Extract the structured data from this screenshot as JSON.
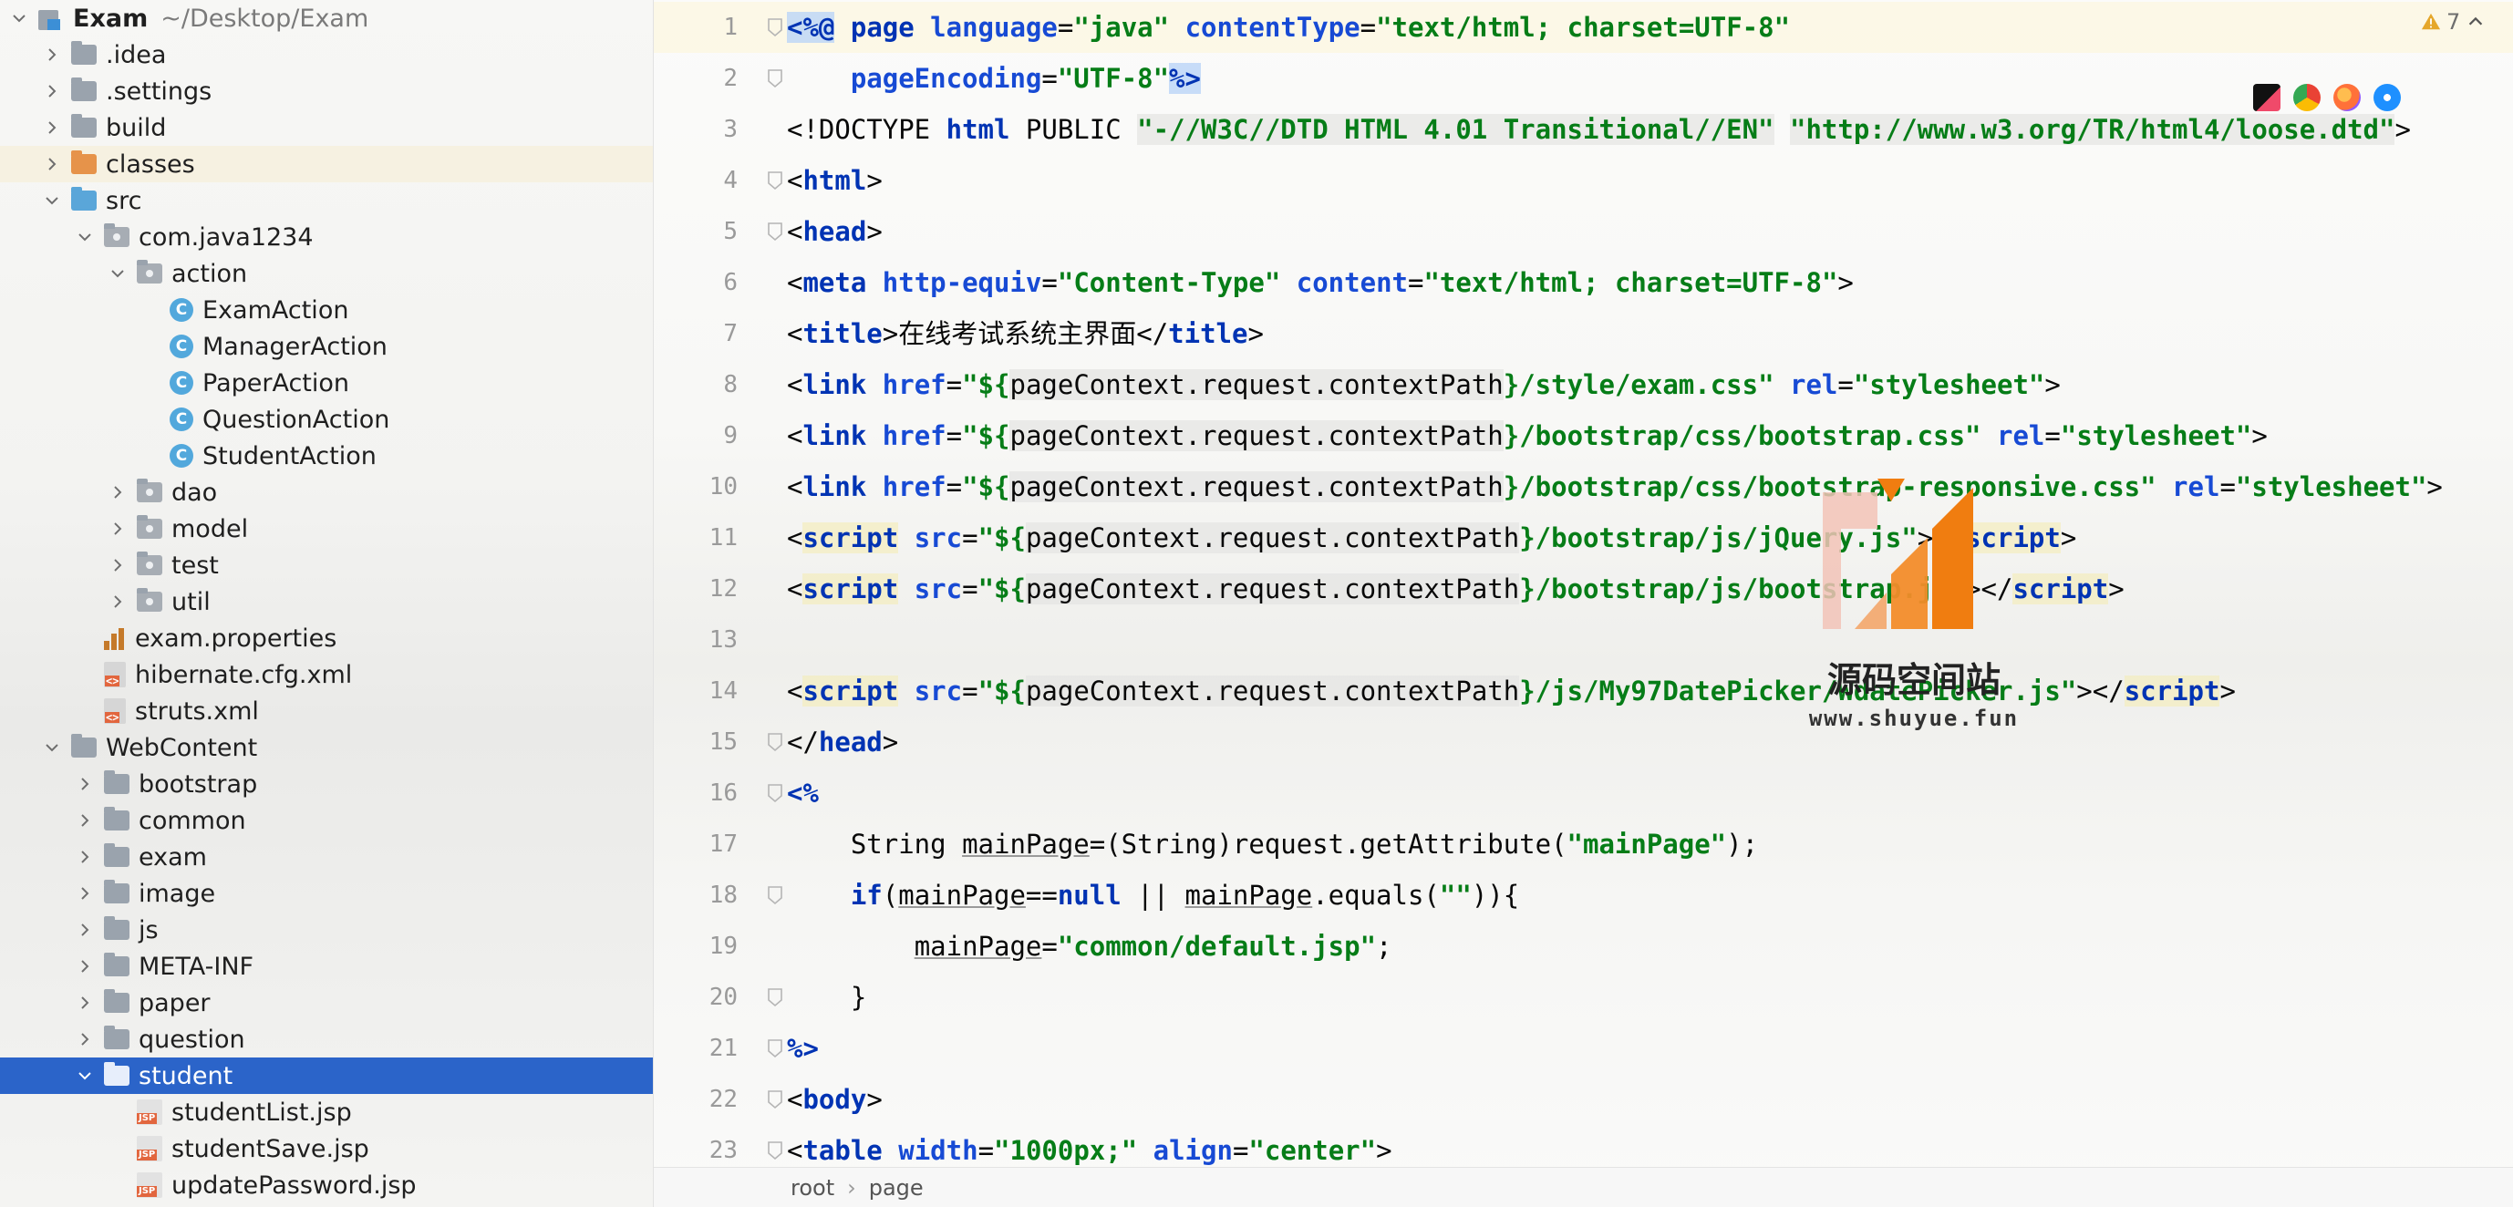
{
  "project": {
    "name": "Exam",
    "path": "~/Desktop/Exam",
    "tree": [
      {
        "label": "Exam",
        "path": "~/Desktop/Exam",
        "depth": 0,
        "type": "project",
        "state": "open"
      },
      {
        "label": ".idea",
        "depth": 1,
        "type": "folder",
        "state": "closed"
      },
      {
        "label": ".settings",
        "depth": 1,
        "type": "folder",
        "state": "closed"
      },
      {
        "label": "build",
        "depth": 1,
        "type": "folder",
        "state": "closed"
      },
      {
        "label": "classes",
        "depth": 1,
        "type": "folder-orange",
        "state": "closed",
        "highlight": true
      },
      {
        "label": "src",
        "depth": 1,
        "type": "folder-blue",
        "state": "open"
      },
      {
        "label": "com.java1234",
        "depth": 2,
        "type": "package",
        "state": "open"
      },
      {
        "label": "action",
        "depth": 3,
        "type": "package",
        "state": "open"
      },
      {
        "label": "ExamAction",
        "depth": 4,
        "type": "class",
        "state": "none"
      },
      {
        "label": "ManagerAction",
        "depth": 4,
        "type": "class",
        "state": "none"
      },
      {
        "label": "PaperAction",
        "depth": 4,
        "type": "class",
        "state": "none"
      },
      {
        "label": "QuestionAction",
        "depth": 4,
        "type": "class",
        "state": "none"
      },
      {
        "label": "StudentAction",
        "depth": 4,
        "type": "class",
        "state": "none"
      },
      {
        "label": "dao",
        "depth": 3,
        "type": "package",
        "state": "closed"
      },
      {
        "label": "model",
        "depth": 3,
        "type": "package",
        "state": "closed"
      },
      {
        "label": "test",
        "depth": 3,
        "type": "package",
        "state": "closed"
      },
      {
        "label": "util",
        "depth": 3,
        "type": "package",
        "state": "closed"
      },
      {
        "label": "exam.properties",
        "depth": 2,
        "type": "properties",
        "state": "none"
      },
      {
        "label": "hibernate.cfg.xml",
        "depth": 2,
        "type": "xml",
        "state": "none"
      },
      {
        "label": "struts.xml",
        "depth": 2,
        "type": "xml",
        "state": "none"
      },
      {
        "label": "WebContent",
        "depth": 1,
        "type": "folder",
        "state": "open"
      },
      {
        "label": "bootstrap",
        "depth": 2,
        "type": "folder",
        "state": "closed"
      },
      {
        "label": "common",
        "depth": 2,
        "type": "folder",
        "state": "closed"
      },
      {
        "label": "exam",
        "depth": 2,
        "type": "folder",
        "state": "closed"
      },
      {
        "label": "image",
        "depth": 2,
        "type": "folder",
        "state": "closed"
      },
      {
        "label": "js",
        "depth": 2,
        "type": "folder",
        "state": "closed"
      },
      {
        "label": "META-INF",
        "depth": 2,
        "type": "folder",
        "state": "closed"
      },
      {
        "label": "paper",
        "depth": 2,
        "type": "folder",
        "state": "closed"
      },
      {
        "label": "question",
        "depth": 2,
        "type": "folder",
        "state": "closed"
      },
      {
        "label": "student",
        "depth": 2,
        "type": "folder",
        "state": "open",
        "selected": true
      },
      {
        "label": "studentList.jsp",
        "depth": 3,
        "type": "jsp",
        "state": "none"
      },
      {
        "label": "studentSave.jsp",
        "depth": 3,
        "type": "jsp",
        "state": "none"
      },
      {
        "label": "updatePassword.jsp",
        "depth": 3,
        "type": "jsp",
        "state": "none"
      }
    ]
  },
  "editor": {
    "warnings_icon": "warning-triangle-icon",
    "warnings_count": "7",
    "browser_icons": [
      "intellij-icon",
      "chrome-icon",
      "firefox-icon",
      "safari-icon"
    ],
    "current_line": 1,
    "lines": [
      {
        "n": "1",
        "fold": true,
        "segs": [
          [
            "hlbg el",
            "<%@"
          ],
          [
            "pl",
            " "
          ],
          [
            "el",
            "page"
          ],
          [
            "pl",
            " "
          ],
          [
            "attr",
            "language"
          ],
          [
            "pl",
            "="
          ],
          [
            "str",
            "\"java\""
          ],
          [
            "pl",
            " "
          ],
          [
            "attr",
            "contentType"
          ],
          [
            "pl",
            "="
          ],
          [
            "str",
            "\"text/html; charset=UTF-8\""
          ]
        ]
      },
      {
        "n": "2",
        "fold": true,
        "segs": [
          [
            "pl",
            "    "
          ],
          [
            "attr",
            "pageEncoding"
          ],
          [
            "pl",
            "="
          ],
          [
            "str",
            "\"UTF-8\""
          ],
          [
            "hlbg el",
            "%>"
          ]
        ]
      },
      {
        "n": "3",
        "fold": false,
        "segs": [
          [
            "pl",
            "<!DOCTYPE "
          ],
          [
            "tag",
            "html"
          ],
          [
            "pl",
            " PUBLIC "
          ],
          [
            "str ebg",
            "\"-//W3C//DTD HTML 4.01 Transitional//EN\""
          ],
          [
            "pl",
            " "
          ],
          [
            "str ebg",
            "\"http://www.w3.org/TR/html4/loose.dtd\""
          ],
          [
            "pl",
            ">"
          ]
        ]
      },
      {
        "n": "4",
        "fold": true,
        "segs": [
          [
            "pl",
            "<"
          ],
          [
            "tag",
            "html"
          ],
          [
            "pl",
            ">"
          ]
        ]
      },
      {
        "n": "5",
        "fold": true,
        "segs": [
          [
            "pl",
            "<"
          ],
          [
            "tag",
            "head"
          ],
          [
            "pl",
            ">"
          ]
        ]
      },
      {
        "n": "6",
        "fold": false,
        "segs": [
          [
            "pl",
            "<"
          ],
          [
            "tag",
            "meta"
          ],
          [
            "pl",
            " "
          ],
          [
            "attr",
            "http-equiv"
          ],
          [
            "pl",
            "="
          ],
          [
            "str",
            "\"Content-Type\""
          ],
          [
            "pl",
            " "
          ],
          [
            "attr",
            "content"
          ],
          [
            "pl",
            "="
          ],
          [
            "str",
            "\"text/html; charset=UTF-8\""
          ],
          [
            "pl",
            ">"
          ]
        ]
      },
      {
        "n": "7",
        "fold": false,
        "segs": [
          [
            "pl",
            "<"
          ],
          [
            "tag",
            "title"
          ],
          [
            "pl",
            ">在线考试系统主界面</"
          ],
          [
            "tag",
            "title"
          ],
          [
            "pl",
            ">"
          ]
        ]
      },
      {
        "n": "8",
        "fold": false,
        "segs": [
          [
            "pl",
            "<"
          ],
          [
            "tag",
            "link"
          ],
          [
            "pl",
            " "
          ],
          [
            "attr",
            "href"
          ],
          [
            "pl",
            "="
          ],
          [
            "str",
            "\"${"
          ],
          [
            "pl ebg",
            "pageContext.request.contextPath"
          ],
          [
            "str",
            "}/style/exam.css\""
          ],
          [
            "pl",
            " "
          ],
          [
            "attr",
            "rel"
          ],
          [
            "pl",
            "="
          ],
          [
            "str",
            "\"stylesheet\""
          ],
          [
            "pl",
            ">"
          ]
        ]
      },
      {
        "n": "9",
        "fold": false,
        "segs": [
          [
            "pl",
            "<"
          ],
          [
            "tag",
            "link"
          ],
          [
            "pl",
            " "
          ],
          [
            "attr",
            "href"
          ],
          [
            "pl",
            "="
          ],
          [
            "str",
            "\"${"
          ],
          [
            "pl ebg",
            "pageContext.request.contextPath"
          ],
          [
            "str",
            "}/bootstrap/css/bootstrap.css\""
          ],
          [
            "pl",
            " "
          ],
          [
            "attr",
            "rel"
          ],
          [
            "pl",
            "="
          ],
          [
            "str",
            "\"stylesheet\""
          ],
          [
            "pl",
            ">"
          ]
        ]
      },
      {
        "n": "10",
        "fold": false,
        "segs": [
          [
            "pl",
            "<"
          ],
          [
            "tag",
            "link"
          ],
          [
            "pl",
            " "
          ],
          [
            "attr",
            "href"
          ],
          [
            "pl",
            "="
          ],
          [
            "str",
            "\"${"
          ],
          [
            "pl ebg",
            "pageContext.request.contextPath"
          ],
          [
            "str",
            "}/bootstrap/css/bootstrap-responsive.css\""
          ],
          [
            "pl",
            " "
          ],
          [
            "attr",
            "rel"
          ],
          [
            "pl",
            "="
          ],
          [
            "str",
            "\"stylesheet\""
          ],
          [
            "pl",
            ">"
          ]
        ]
      },
      {
        "n": "11",
        "fold": false,
        "segs": [
          [
            "pl",
            "<"
          ],
          [
            "tag scrbg",
            "script"
          ],
          [
            "pl",
            " "
          ],
          [
            "attr",
            "src"
          ],
          [
            "pl",
            "="
          ],
          [
            "str",
            "\"${"
          ],
          [
            "pl ebg",
            "pageContext.request.contextPath"
          ],
          [
            "str",
            "}/bootstrap/js/jQuery.js\""
          ],
          [
            "pl",
            "></"
          ],
          [
            "tag scrbg",
            "script"
          ],
          [
            "pl",
            ">"
          ]
        ]
      },
      {
        "n": "12",
        "fold": false,
        "segs": [
          [
            "pl",
            "<"
          ],
          [
            "tag scrbg",
            "script"
          ],
          [
            "pl",
            " "
          ],
          [
            "attr",
            "src"
          ],
          [
            "pl",
            "="
          ],
          [
            "str",
            "\"${"
          ],
          [
            "pl ebg",
            "pageContext.request.contextPath"
          ],
          [
            "str",
            "}/bootstrap/js/bootstrap.js\""
          ],
          [
            "pl",
            "></"
          ],
          [
            "tag scrbg",
            "script"
          ],
          [
            "pl",
            ">"
          ]
        ]
      },
      {
        "n": "13",
        "fold": false,
        "segs": []
      },
      {
        "n": "14",
        "fold": false,
        "segs": [
          [
            "pl",
            "<"
          ],
          [
            "tag scrbg",
            "script"
          ],
          [
            "pl",
            " "
          ],
          [
            "attr",
            "src"
          ],
          [
            "pl",
            "="
          ],
          [
            "str",
            "\"${"
          ],
          [
            "pl ebg",
            "pageContext.request.contextPath"
          ],
          [
            "str",
            "}/js/My97DatePicker/WdatePicker.js\""
          ],
          [
            "pl",
            "></"
          ],
          [
            "tag scrbg",
            "script"
          ],
          [
            "pl",
            ">"
          ]
        ]
      },
      {
        "n": "15",
        "fold": true,
        "segs": [
          [
            "pl",
            "</"
          ],
          [
            "tag",
            "head"
          ],
          [
            "pl",
            ">"
          ]
        ]
      },
      {
        "n": "16",
        "fold": true,
        "segs": [
          [
            "el",
            "<%"
          ]
        ]
      },
      {
        "n": "17",
        "fold": false,
        "segs": [
          [
            "pl",
            "    String "
          ],
          [
            "pl ul",
            "mainPage"
          ],
          [
            "pl",
            "=(String)request.getAttribute("
          ],
          [
            "str",
            "\"mainPage\""
          ],
          [
            "pl",
            ");"
          ]
        ]
      },
      {
        "n": "18",
        "fold": true,
        "segs": [
          [
            "pl",
            "    "
          ],
          [
            "kw",
            "if"
          ],
          [
            "pl",
            "("
          ],
          [
            "pl ul",
            "mainPage"
          ],
          [
            "pl",
            "=="
          ],
          [
            "kw",
            "null"
          ],
          [
            "pl",
            " || "
          ],
          [
            "pl ul",
            "mainPage"
          ],
          [
            "pl",
            ".equals("
          ],
          [
            "str",
            "\"\""
          ],
          [
            "pl",
            "))"
          ],
          [
            "pl",
            "{"
          ]
        ]
      },
      {
        "n": "19",
        "fold": false,
        "segs": [
          [
            "pl",
            "        "
          ],
          [
            "pl ul",
            "mainPage"
          ],
          [
            "pl",
            "="
          ],
          [
            "str",
            "\"common/default.jsp\""
          ],
          [
            "pl",
            ";"
          ]
        ]
      },
      {
        "n": "20",
        "fold": true,
        "segs": [
          [
            "pl",
            "    }"
          ]
        ]
      },
      {
        "n": "21",
        "fold": true,
        "segs": [
          [
            "el",
            "%>"
          ]
        ]
      },
      {
        "n": "22",
        "fold": true,
        "segs": [
          [
            "pl",
            "<"
          ],
          [
            "tag",
            "body"
          ],
          [
            "pl",
            ">"
          ]
        ]
      },
      {
        "n": "23",
        "fold": true,
        "segs": [
          [
            "pl",
            "<"
          ],
          [
            "tag",
            "table"
          ],
          [
            "pl",
            " "
          ],
          [
            "attr",
            "width"
          ],
          [
            "pl",
            "="
          ],
          [
            "str",
            "\"1000px;\""
          ],
          [
            "pl",
            " "
          ],
          [
            "attr",
            "align"
          ],
          [
            "pl",
            "="
          ],
          [
            "str",
            "\"center\""
          ],
          [
            "pl",
            ">"
          ]
        ]
      }
    ]
  },
  "breadcrumb": [
    "root",
    "page"
  ],
  "watermark": {
    "title": "源码空间站",
    "url": "www.shuyue.fun"
  },
  "colors": {
    "selection": "#2b64c9",
    "tag": "#0033b3",
    "string": "#067d17",
    "attribute": "#174ad4"
  }
}
